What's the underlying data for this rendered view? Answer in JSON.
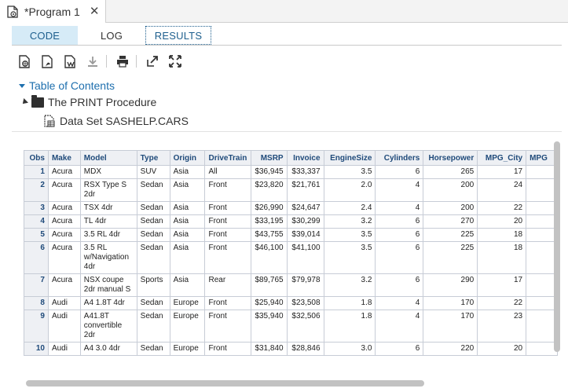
{
  "editor_tab": {
    "title": "*Program 1",
    "close": "✕"
  },
  "view_tabs": {
    "code": "CODE",
    "log": "LOG",
    "results": "RESULTS"
  },
  "toolbar": {
    "icons": [
      "download-html-icon",
      "download-pdf-icon",
      "download-word-icon",
      "download-icon",
      "print-icon",
      "open-new-window-icon",
      "expand-icon"
    ]
  },
  "toc": {
    "root": "Table of Contents",
    "procedure": "The PRINT Procedure",
    "dataset": "Data Set SASHELP.CARS"
  },
  "table": {
    "headers": [
      "Obs",
      "Make",
      "Model",
      "Type",
      "Origin",
      "DriveTrain",
      "MSRP",
      "Invoice",
      "EngineSize",
      "Cylinders",
      "Horsepower",
      "MPG_City",
      "MPG"
    ],
    "rows": [
      [
        "1",
        "Acura",
        "MDX",
        "SUV",
        "Asia",
        "All",
        "$36,945",
        "$33,337",
        "3.5",
        "6",
        "265",
        "17",
        ""
      ],
      [
        "2",
        "Acura",
        "RSX Type S 2dr",
        "Sedan",
        "Asia",
        "Front",
        "$23,820",
        "$21,761",
        "2.0",
        "4",
        "200",
        "24",
        ""
      ],
      [
        "3",
        "Acura",
        "TSX 4dr",
        "Sedan",
        "Asia",
        "Front",
        "$26,990",
        "$24,647",
        "2.4",
        "4",
        "200",
        "22",
        ""
      ],
      [
        "4",
        "Acura",
        "TL 4dr",
        "Sedan",
        "Asia",
        "Front",
        "$33,195",
        "$30,299",
        "3.2",
        "6",
        "270",
        "20",
        ""
      ],
      [
        "5",
        "Acura",
        "3.5 RL 4dr",
        "Sedan",
        "Asia",
        "Front",
        "$43,755",
        "$39,014",
        "3.5",
        "6",
        "225",
        "18",
        ""
      ],
      [
        "6",
        "Acura",
        "3.5 RL w/Navigation 4dr",
        "Sedan",
        "Asia",
        "Front",
        "$46,100",
        "$41,100",
        "3.5",
        "6",
        "225",
        "18",
        ""
      ],
      [
        "7",
        "Acura",
        "NSX coupe 2dr manual S",
        "Sports",
        "Asia",
        "Rear",
        "$89,765",
        "$79,978",
        "3.2",
        "6",
        "290",
        "17",
        ""
      ],
      [
        "8",
        "Audi",
        "A4 1.8T 4dr",
        "Sedan",
        "Europe",
        "Front",
        "$25,940",
        "$23,508",
        "1.8",
        "4",
        "170",
        "22",
        ""
      ],
      [
        "9",
        "Audi",
        "A41.8T convertible 2dr",
        "Sedan",
        "Europe",
        "Front",
        "$35,940",
        "$32,506",
        "1.8",
        "4",
        "170",
        "23",
        ""
      ],
      [
        "10",
        "Audi",
        "A4 3.0 4dr",
        "Sedan",
        "Europe",
        "Front",
        "$31,840",
        "$28,846",
        "3.0",
        "6",
        "220",
        "20",
        ""
      ]
    ]
  }
}
